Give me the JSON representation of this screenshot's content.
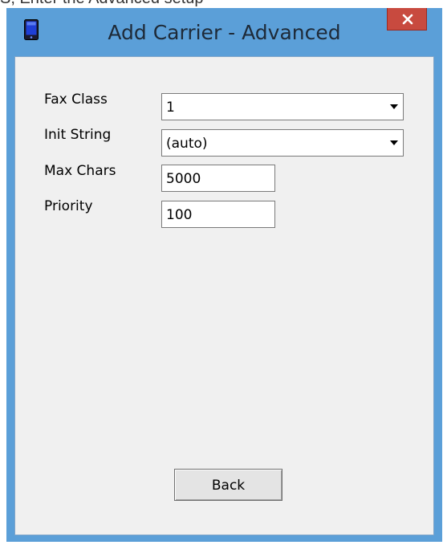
{
  "background_text": "S, Enter the Advanced setup",
  "window": {
    "title": "Add Carrier - Advanced",
    "icon": "fax-device-icon",
    "close_icon": "close-icon"
  },
  "form": {
    "fax_class": {
      "label": "Fax Class",
      "value": "1"
    },
    "init_string": {
      "label": "Init String",
      "value": "(auto)"
    },
    "max_chars": {
      "label": "Max Chars",
      "value": "5000"
    },
    "priority": {
      "label": "Priority",
      "value": "100"
    }
  },
  "buttons": {
    "back_label": "Back"
  },
  "colors": {
    "window_frame": "#5b9fd8",
    "client_background": "#f0f0f0",
    "close_button": "#c84a3f"
  }
}
